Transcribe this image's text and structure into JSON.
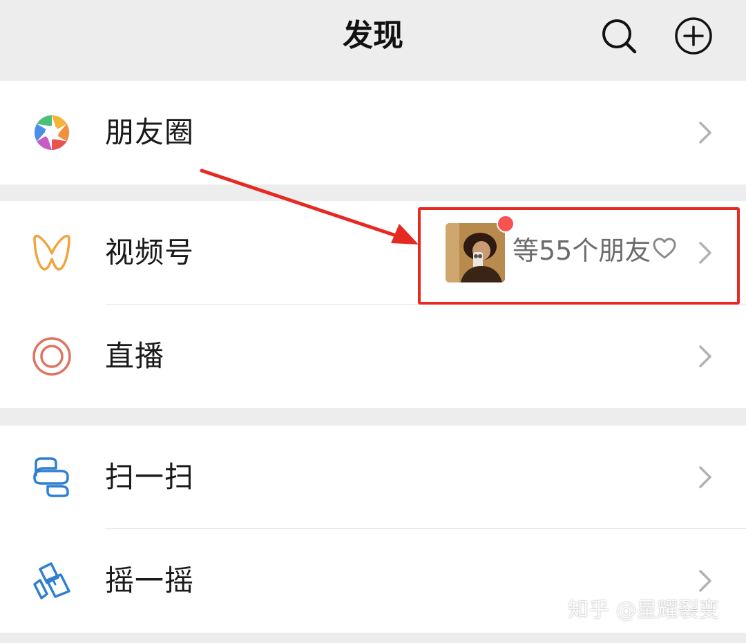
{
  "header": {
    "title": "发现",
    "search_icon": "search-icon",
    "add_icon": "plus-circle-icon"
  },
  "menu": {
    "moments": {
      "label": "朋友圈",
      "icon": "moments-aperture-icon"
    },
    "channels": {
      "label": "视频号",
      "icon": "channels-icon",
      "friends_text": "等55个朋友",
      "heart_icon": "heart-outline-icon",
      "has_unread_dot": true
    },
    "live": {
      "label": "直播",
      "icon": "live-icon"
    },
    "scan": {
      "label": "扫一扫",
      "icon": "scan-icon"
    },
    "shake": {
      "label": "摇一摇",
      "icon": "shake-icon"
    }
  },
  "watermark": "知乎 @星耀裂变",
  "colors": {
    "annotation_red": "#e52a22",
    "unread_dot": "#fa5151",
    "background": "#ededed",
    "channels_orange": "#f0a43c",
    "live_red": "#e0735f",
    "scan_blue": "#2f7fd1"
  }
}
